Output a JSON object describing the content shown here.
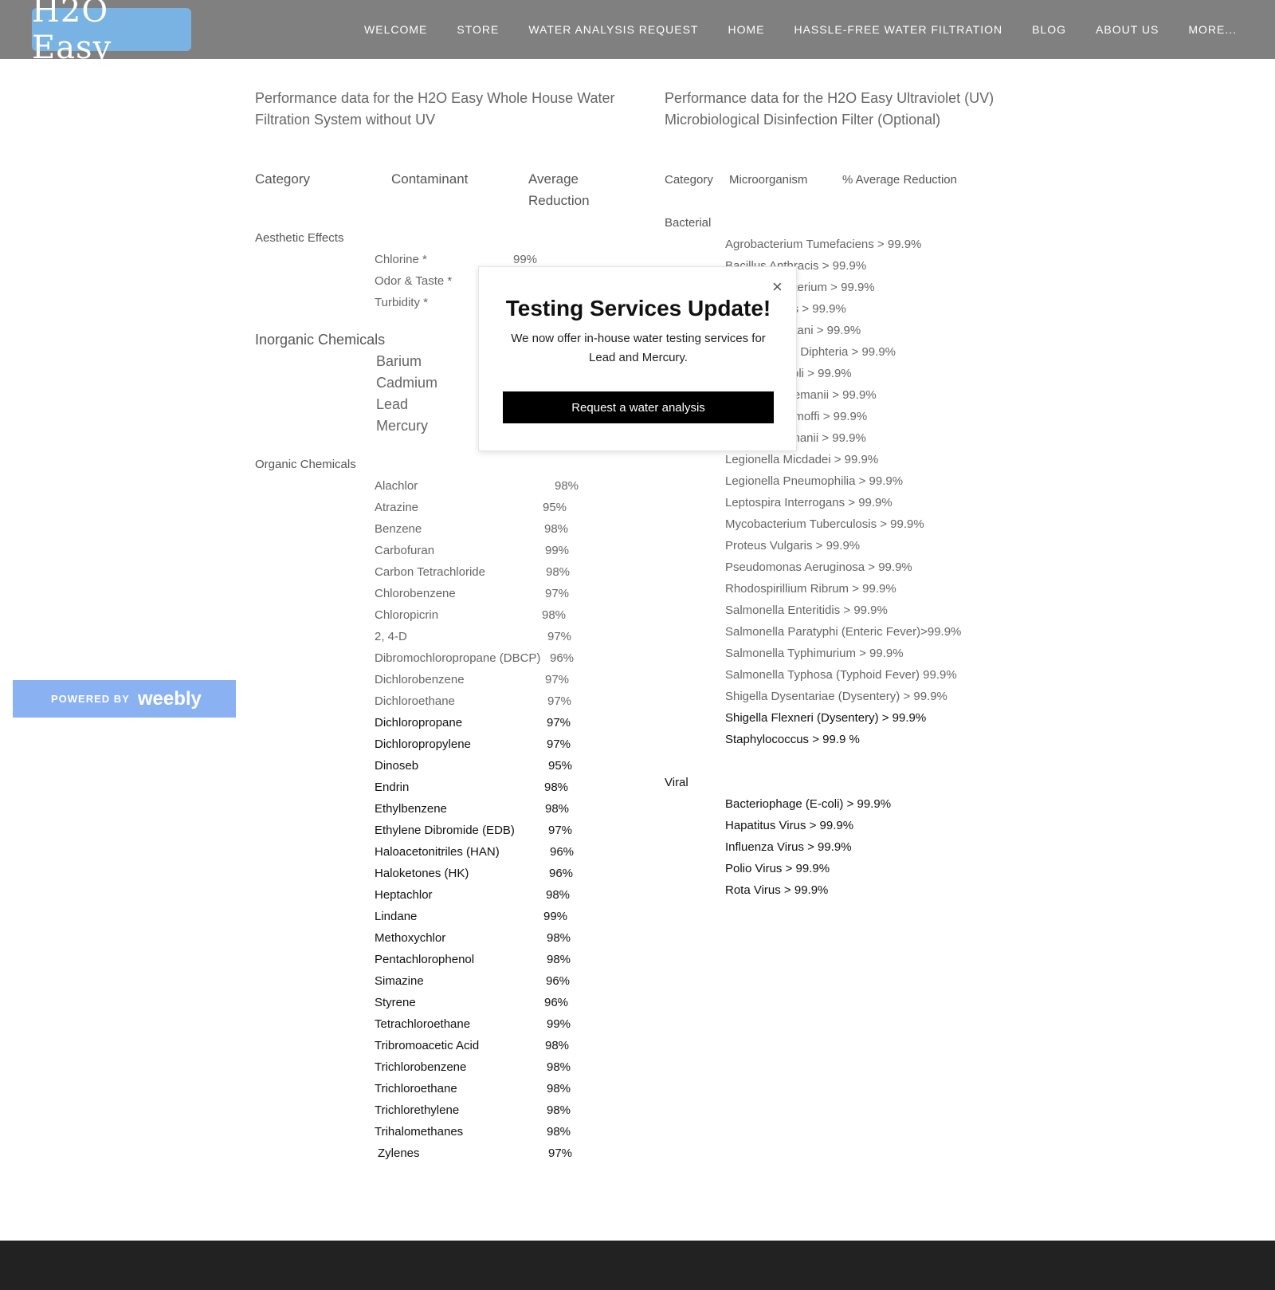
{
  "header": {
    "logo_text": "H2O Easy",
    "nav": [
      "WELCOME",
      "STORE",
      "WATER ANALYSIS REQUEST",
      "HOME",
      "HASSLE-FREE WATER FILTRATION",
      "BLOG",
      "ABOUT US",
      "MORE..."
    ]
  },
  "left": {
    "heading": [
      "Performance data for the H2O Easy Whole House Water",
      "Filtration System without UV"
    ],
    "columns": {
      "category": "Category",
      "contaminant": "Contaminant",
      "avg1": "Average",
      "avg2": "Reduction"
    },
    "aesthetic": {
      "category": "Aesthetic Effects",
      "items": [
        {
          "name": "Chlorine *",
          "value": "99%"
        },
        {
          "name": "Odor & Taste *",
          "value": ""
        },
        {
          "name": "Turbidity *",
          "value": ""
        }
      ]
    },
    "inorganic": {
      "category": "Inorganic Chemicals",
      "items": [
        "Barium",
        "Cadmium",
        "Lead",
        "Mercury"
      ]
    },
    "organic": {
      "category": "Organic Chemicals",
      "items": [
        {
          "name": "Alachlor",
          "value": "98%"
        },
        {
          "name": "Atrazine",
          "value": "95%"
        },
        {
          "name": "Benzene",
          "value": "98%"
        },
        {
          "name": "Carbofuran",
          "value": "99%"
        },
        {
          "name": "Carbon Tetrachloride",
          "value": "98%"
        },
        {
          "name": "Chlorobenzene",
          "value": "97%"
        },
        {
          "name": "Chloropicrin",
          "value": "98%"
        },
        {
          "name": "2, 4-D",
          "value": "97%"
        },
        {
          "name": "Dibromochloropropane (DBCP)",
          "value": "96%"
        },
        {
          "name": "Dichlorobenzene",
          "value": "97%"
        },
        {
          "name": "Dichloroethane",
          "value": "97%"
        },
        {
          "name": "Dichloropropane",
          "value": "97%"
        },
        {
          "name": "Dichloropropylene",
          "value": "97%"
        },
        {
          "name": "Dinoseb",
          "value": "95%"
        },
        {
          "name": "Endrin",
          "value": "98%"
        },
        {
          "name": "Ethylbenzene",
          "value": "98%"
        },
        {
          "name": "Ethylene Dibromide (EDB)",
          "value": "97%"
        },
        {
          "name": "Haloacetonitriles (HAN)",
          "value": "96%"
        },
        {
          "name": "Haloketones (HK)",
          "value": "96%"
        },
        {
          "name": "Heptachlor",
          "value": "98%"
        },
        {
          "name": "Lindane",
          "value": "99%"
        },
        {
          "name": "Methoxychlor",
          "value": "98%"
        },
        {
          "name": "Pentachlorophenol",
          "value": "98%"
        },
        {
          "name": "Simazine",
          "value": "96%"
        },
        {
          "name": "Styrene",
          "value": "96%"
        },
        {
          "name": "Tetrachloroethane",
          "value": "99%"
        },
        {
          "name": "Tribromoacetic Acid",
          "value": "98%"
        },
        {
          "name": "Trichlorobenzene",
          "value": "98%"
        },
        {
          "name": "Trichloroethane",
          "value": "98%"
        },
        {
          "name": "Trichlorethylene",
          "value": "98%"
        },
        {
          "name": "Trihalomethanes",
          "value": "98%"
        },
        {
          "name": "Zylenes",
          "value": "97%"
        }
      ]
    }
  },
  "right": {
    "heading": [
      "Performance data for the H2O Easy Ultraviolet (UV)",
      "Microbiological Disinfection Filter (Optional)"
    ],
    "columns": {
      "category": "Category",
      "organism": "Microorganism",
      "reduction": "% Average Reduction"
    },
    "bacterial": {
      "category": "Bacterial",
      "items": [
        "Agrobacterium Tumefaciens  > 99.9%",
        "Bacillus Anthracis  > 99.9%",
        "aterium  > 99.9%",
        "lis  > 99.9%",
        "etani  > 99.9%",
        "ium Diphteria  > 99.9%",
        "oli  > 99.9%",
        "ozemanii  > 99.9%",
        "umoffi  > 99.9%",
        "ormanii  > 99.9%",
        "Legionella Micdadei  >  99.9%",
        "Legionella Pneumophilia  > 99.9%",
        "Leptospira Interrogans  > 99.9%",
        "Mycobacterium Tuberculosis  > 99.9%",
        "Proteus Vulgaris  > 99.9%",
        "Pseudomonas Aeruginosa  > 99.9%",
        "Rhodospirillium Ribrum  > 99.9%",
        "Salmonella Enteritidis  > 99.9%",
        "Salmonella Paratyphi (Enteric Fever)>99.9%",
        "Salmonella Typhimurium  > 99.9%",
        "Salmonella Typhosa (Typhoid Fever)  99.9%",
        "Shigella Dysentariae (Dysentery)  > 99.9%",
        "Shigella Flexneri (Dysentery)  > 99.9%",
        "Staphylococcus  > 99.9 %"
      ]
    },
    "viral": {
      "category": "Viral",
      "items": [
        "Bacteriophage (E-coli)  > 99.9%",
        "Hapatitus Virus  > 99.9%",
        "Influenza Virus  > 99.9%",
        "Polio Virus  > 99.9%",
        "Rota Virus  > 99.9%"
      ]
    }
  },
  "weebly": {
    "powered": "POWERED BY",
    "brand": "weebly"
  },
  "modal": {
    "close": "×",
    "title": "Testing Services Update!",
    "body": "We now offer in-house water testing services for Lead and Mercury.",
    "button": "Request a water analysis"
  }
}
